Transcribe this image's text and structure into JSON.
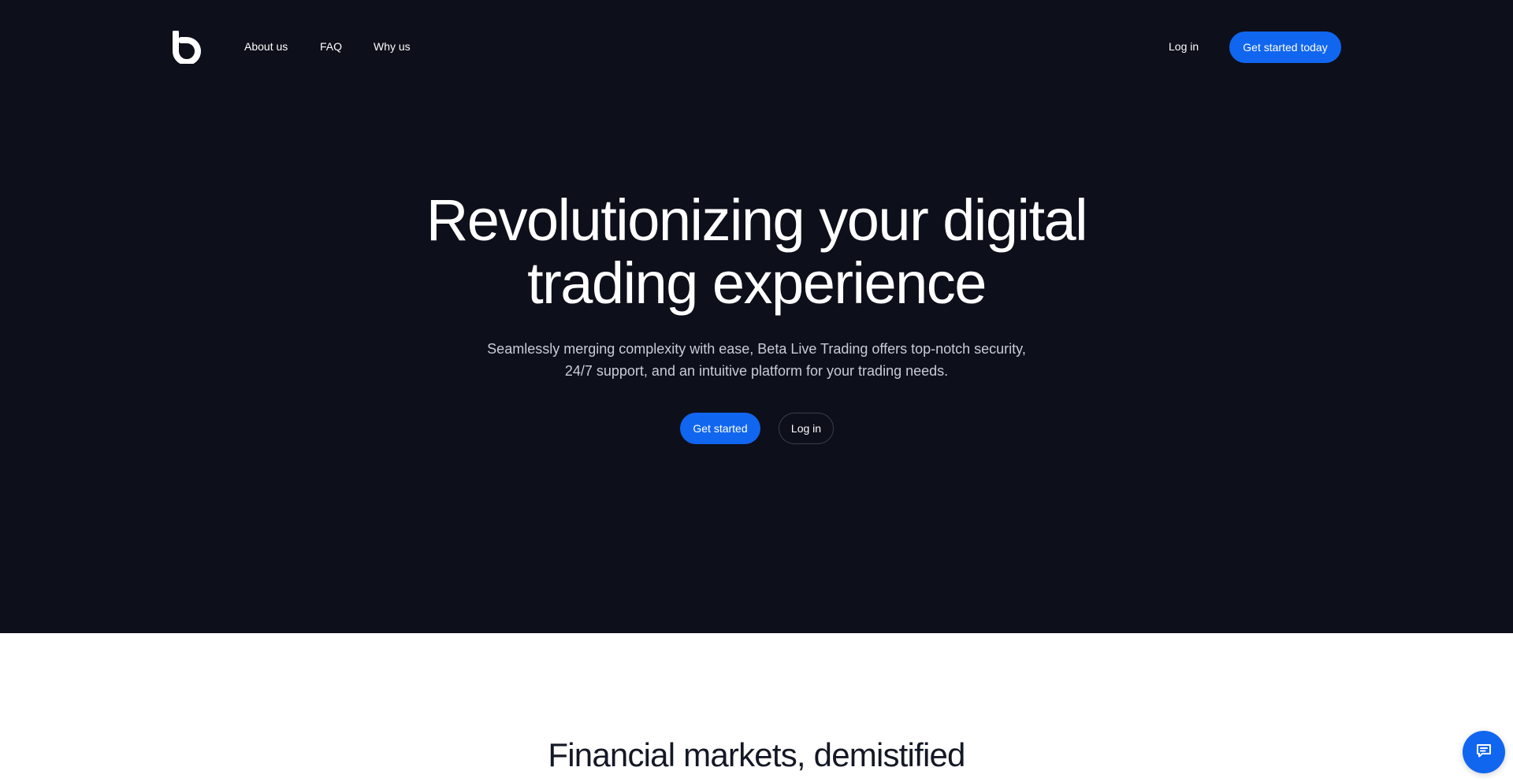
{
  "colors": {
    "hero_bg": "#0d0f1a",
    "accent": "#1166f0",
    "text_light": "#ffffff",
    "text_muted": "#c9ccd6",
    "heading_dark": "#141826"
  },
  "nav": {
    "logo_icon": "b-logo-icon",
    "links": [
      "About us",
      "FAQ",
      "Why us"
    ],
    "login_label": "Log in",
    "cta_label": "Get started today"
  },
  "hero": {
    "title_line1": "Revolutionizing your digital",
    "title_line2": "trading experience",
    "subtitle_line1": "Seamlessly merging complexity with ease, Beta Live Trading offers top-notch security,",
    "subtitle_line2": "24/7 support, and an intuitive platform for your trading needs.",
    "primary_button": "Get started",
    "secondary_button": "Log in"
  },
  "section2": {
    "title": "Financial markets, demistified"
  },
  "chat": {
    "icon": "chat-icon"
  }
}
